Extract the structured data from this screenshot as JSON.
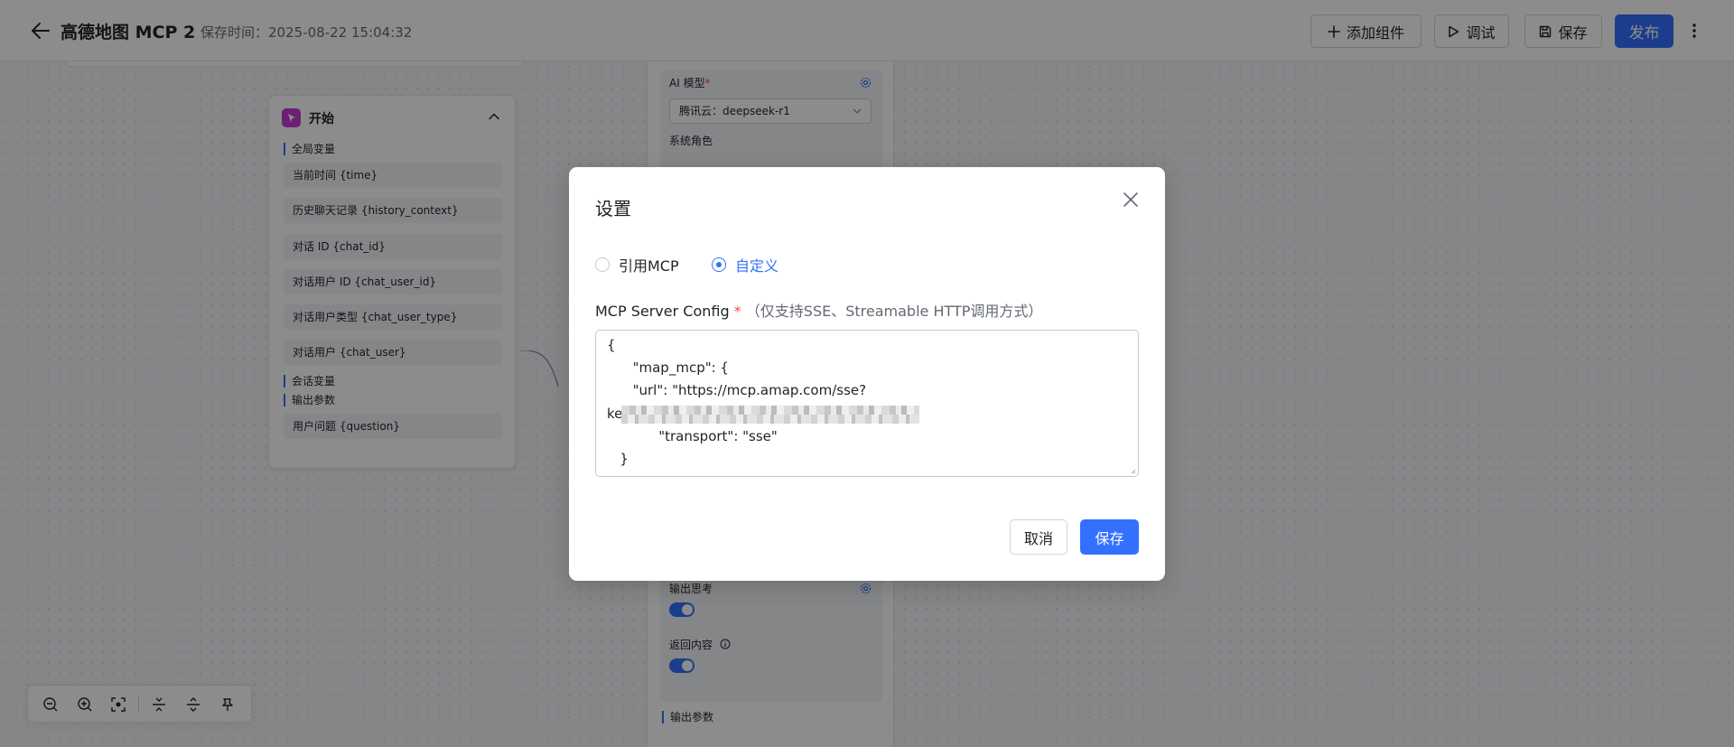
{
  "header": {
    "title": "高德地图 MCP 2",
    "save_time": "保存时间：2025-08-22 15:04:32",
    "add_component": "添加组件",
    "debug": "调试",
    "save": "保存",
    "publish": "发布"
  },
  "start_node": {
    "title": "开始",
    "global_vars_label": "全局变量",
    "global_vars": [
      "当前时间 {time}",
      "历史聊天记录 {history_context}",
      "对话 ID {chat_id}",
      "对话用户 ID {chat_user_id}",
      "对话用户类型 {chat_user_type}",
      "对话用户 {chat_user}"
    ],
    "session_vars_label": "会话变量",
    "output_params_label": "输出参数",
    "output_params": [
      "用户问题 {question}"
    ]
  },
  "ai_node": {
    "model_label": "AI 模型",
    "model_value": "腾讯云：deepseek-r1",
    "system_role_label": "系统角色",
    "output_thinking_label": "输出思考",
    "return_content_label": "返回内容",
    "output_params_label": "输出参数"
  },
  "dialog": {
    "title": "设置",
    "radio_ref": "引用MCP",
    "radio_custom": "自定义",
    "selected": "custom",
    "config_label": "MCP Server Config",
    "config_hint": "（仅支持SSE、Streamable HTTP调用方式）",
    "config_lines": [
      "{",
      "      \"map_mcp\": {",
      "      \"url\": \"https://mcp.amap.com/sse?",
      "ke",
      "            \"transport\": \"sse\"",
      "   }"
    ],
    "cancel": "取消",
    "save": "保存"
  },
  "colors": {
    "primary": "#3370ff",
    "required": "#f54a45",
    "start_icon": "#c43bd6"
  }
}
